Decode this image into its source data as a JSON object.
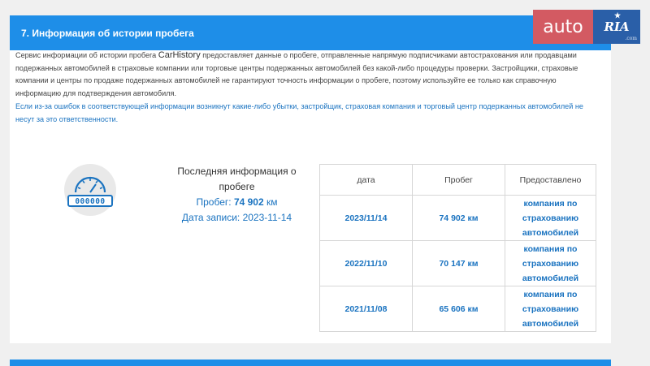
{
  "section": {
    "title": "7. Информация об истории пробега"
  },
  "description": {
    "part1": "Сервис информации об истории пробега ",
    "brand": "CarHistory",
    "part2": " предоставляет данные о пробеге, отправленные напрямую подписчиками автострахования или продавцами подержанных автомобилей в страховые компании или торговые центры подержанных автомобилей без какой-либо процедуры проверки. Застройщики, страховые компании и центры по продаже подержанных автомобилей не гарантируют точность информации о пробеге, поэтому используйте ее только как справочную информацию для подтверждения автомобиля.",
    "warning": "Если из-за ошибок в соответствующей информации возникнут какие-либо убытки, застройщик, страховая компания и торговый центр подержанных автомобилей не несут за это ответственности."
  },
  "gauge": {
    "icon": "odometer-icon",
    "digits": "000000"
  },
  "summary": {
    "heading": "Последняя информация о пробеге",
    "mileage_label": "Пробег: ",
    "mileage_value": "74 902",
    "mileage_unit": " км",
    "date_label": "Дата записи: ",
    "date_value": "2023-11-14"
  },
  "table": {
    "headers": {
      "date": "дата",
      "mileage": "Пробег",
      "provider": "Предоставлено"
    },
    "rows": [
      {
        "date": "2023/11/14",
        "mileage": "74 902 км",
        "provider": "компания по страхованию автомобилей"
      },
      {
        "date": "2022/11/10",
        "mileage": "70 147 км",
        "provider": "компания по страхованию автомобилей"
      },
      {
        "date": "2021/11/08",
        "mileage": "65 606 км",
        "provider": "компания по страхованию автомобилей"
      }
    ]
  },
  "logo": {
    "auto": "auto",
    "ria": "RIA",
    "com": ".com"
  },
  "colors": {
    "accent": "#1e8ee8",
    "link": "#1a73c0",
    "logo_red": "#d35a62",
    "logo_blue": "#2a5fa8"
  }
}
